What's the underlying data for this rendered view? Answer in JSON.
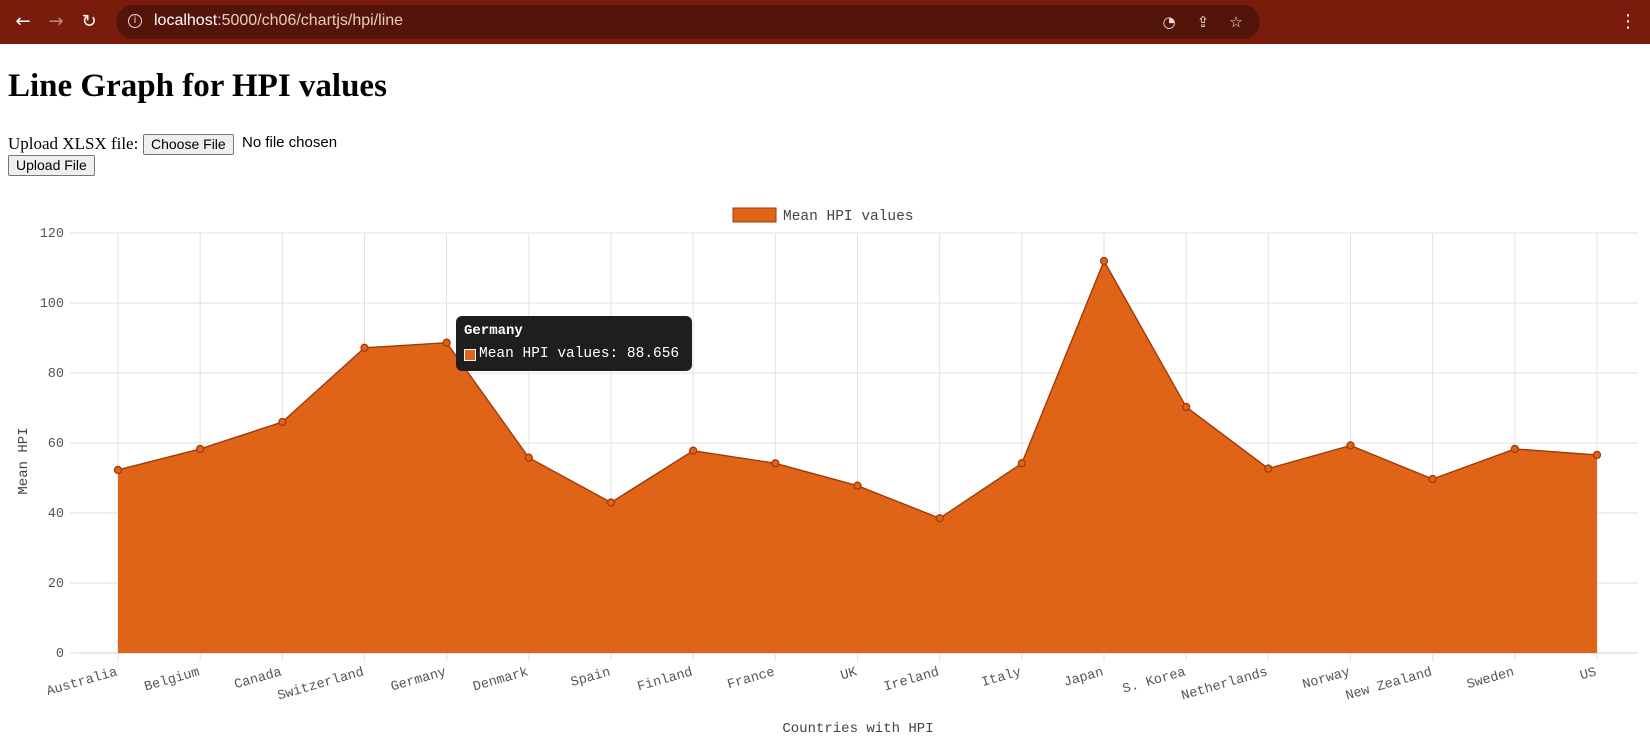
{
  "browser": {
    "url_host": "localhost",
    "url_path": ":5000/ch06/chartjs/hpi/line",
    "icons": [
      "back-icon",
      "forward-icon",
      "reload-icon",
      "site-info-icon",
      "performance-icon",
      "share-icon",
      "bookmark-star-icon",
      "kebab-menu-icon"
    ]
  },
  "page": {
    "title": "Line Graph for HPI values",
    "upload_label": "Upload XLSX file:",
    "choose_file_label": "Choose File",
    "no_file_text": "No file chosen",
    "upload_button": "Upload File"
  },
  "tooltip": {
    "title": "Germany",
    "label": "Mean HPI values: 88.656"
  },
  "chart_data": {
    "type": "area",
    "categories": [
      "Australia",
      "Belgium",
      "Canada",
      "Switzerland",
      "Germany",
      "Denmark",
      "Spain",
      "Finland",
      "France",
      "UK",
      "Ireland",
      "Italy",
      "Japan",
      "S. Korea",
      "Netherlands",
      "Norway",
      "New Zealand",
      "Sweden",
      "US"
    ],
    "series": [
      {
        "name": "Mean HPI values",
        "values": [
          52.3,
          58.3,
          66.0,
          87.2,
          88.656,
          55.8,
          43.0,
          57.8,
          54.2,
          47.8,
          38.5,
          54.2,
          112.0,
          70.3,
          52.7,
          59.3,
          49.7,
          58.3,
          56.6
        ],
        "color": "#e06418",
        "border_color": "#a13a0a"
      }
    ],
    "xlabel": "Countries with HPI",
    "ylabel": "Mean HPI",
    "ylim": [
      0,
      120
    ],
    "yticks": [
      "0",
      "20",
      "40",
      "60",
      "80",
      "100",
      "120"
    ],
    "grid": true,
    "legend_position": "top-center"
  }
}
